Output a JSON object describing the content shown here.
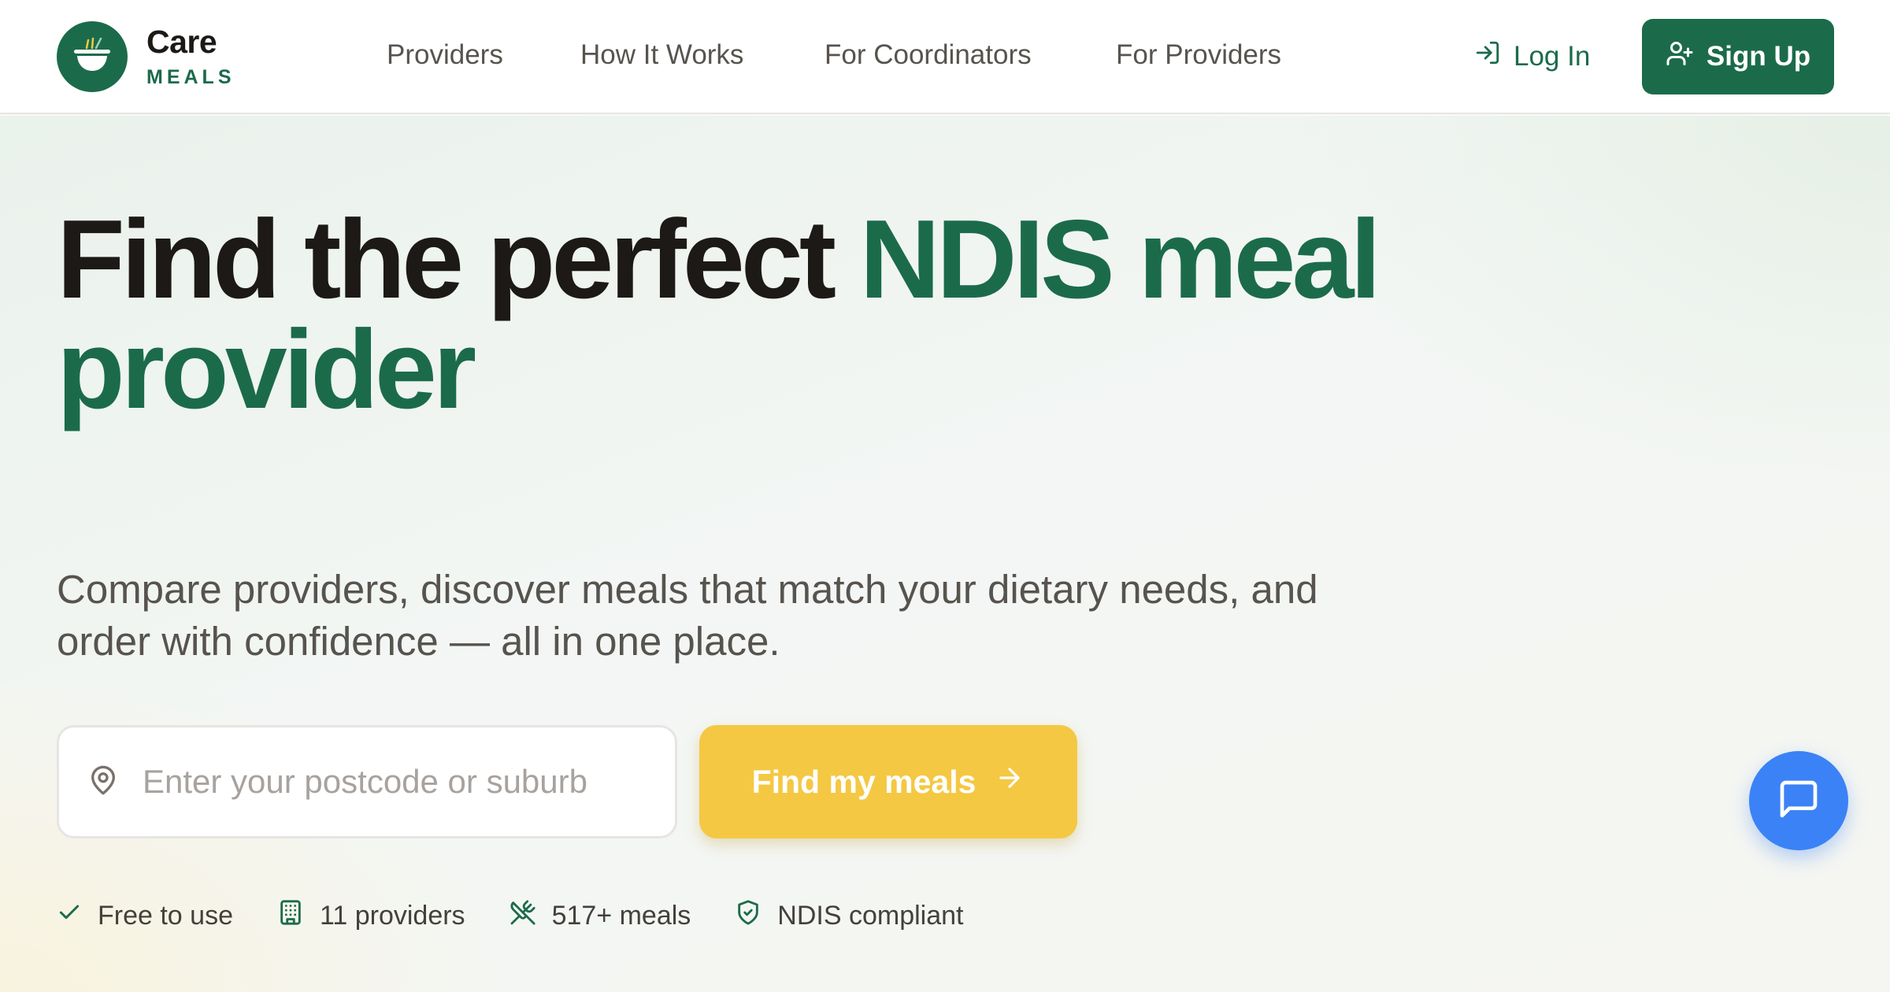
{
  "brand": {
    "name": "Care",
    "tagline": "MEALS",
    "accent_color": "#1b6b4b",
    "logo_icon": "bowl-icon"
  },
  "nav": {
    "items": [
      {
        "label": "Providers"
      },
      {
        "label": "How It Works"
      },
      {
        "label": "For Coordinators"
      },
      {
        "label": "For Providers"
      }
    ]
  },
  "auth": {
    "login_label": "Log In",
    "login_icon": "log-in-icon",
    "signup_label": "Sign Up",
    "signup_icon": "user-plus-icon"
  },
  "hero": {
    "headline_part1": "Find the perfect ",
    "headline_part2": "NDIS meal provider",
    "subheadline": "Compare providers, discover meals that match your dietary needs, and order with confidence — all in one place.",
    "search": {
      "placeholder": "Enter your postcode or suburb",
      "value": "",
      "icon": "map-pin-icon"
    },
    "cta_label": "Find my meals",
    "cta_color": "#f4c842",
    "features": [
      {
        "icon": "check-icon",
        "label": "Free to use"
      },
      {
        "icon": "building-icon",
        "label": "11 providers"
      },
      {
        "icon": "utensils-crossed-icon",
        "label": "517+ meals"
      },
      {
        "icon": "shield-check-icon",
        "label": "NDIS compliant"
      }
    ]
  },
  "chat": {
    "icon": "message-square-icon",
    "color": "#3b82f6"
  }
}
